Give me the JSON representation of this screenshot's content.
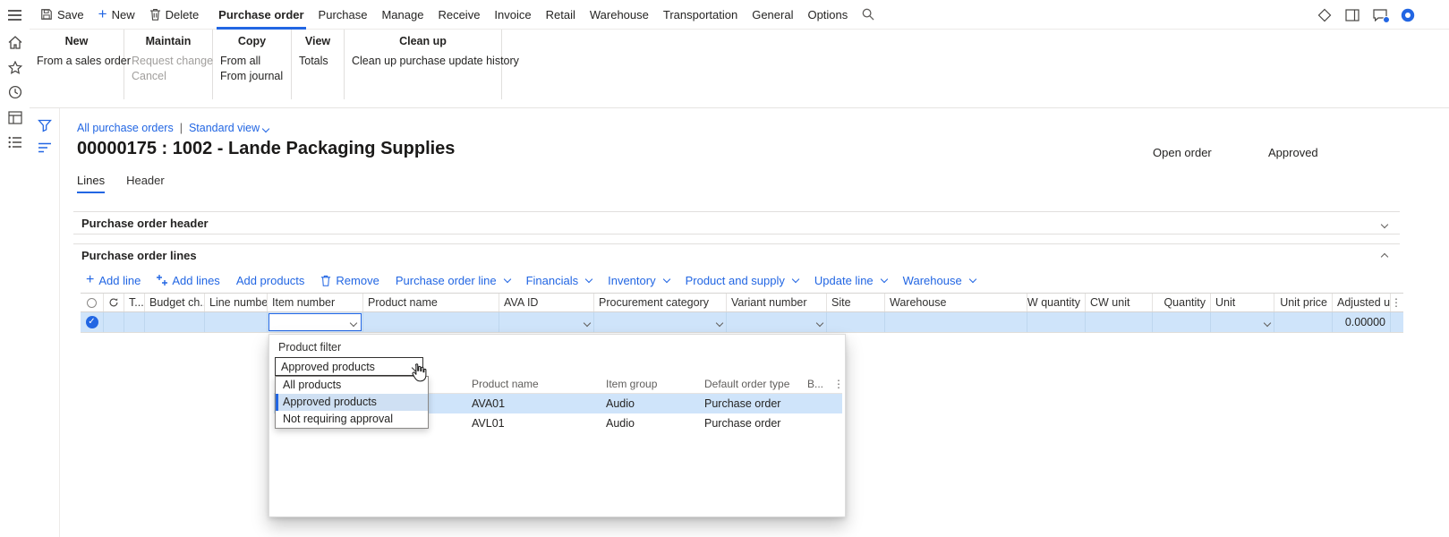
{
  "accent_color": "#2266E3",
  "row_selection_color": "#CFE4FA",
  "topbar": {
    "save": "Save",
    "new": "New",
    "delete": "Delete",
    "menus": [
      "Purchase order",
      "Purchase",
      "Manage",
      "Receive",
      "Invoice",
      "Retail",
      "Warehouse",
      "Transportation",
      "General",
      "Options"
    ]
  },
  "ribbon": {
    "groups": [
      {
        "title": "New",
        "items": [
          "From a sales order"
        ]
      },
      {
        "title": "Maintain",
        "items": [
          "Request change",
          "Cancel"
        ]
      },
      {
        "title": "Copy",
        "items": [
          "From all",
          "From journal"
        ]
      },
      {
        "title": "View",
        "items": [
          "Totals"
        ]
      },
      {
        "title": "Clean up",
        "items": [
          "Clean up purchase update history"
        ]
      }
    ]
  },
  "page": {
    "breadcrumb": "All purchase orders",
    "separator": "|",
    "view_selector": "Standard view",
    "title": "00000175 : 1002 - Lande Packaging Supplies",
    "order_status": "Open order",
    "approval_status": "Approved",
    "tabs": [
      "Lines",
      "Header"
    ]
  },
  "sections": {
    "header": "Purchase order header",
    "lines": "Purchase order lines"
  },
  "lines_toolbar": {
    "items": [
      "Add line",
      "Add lines",
      "Add products",
      "Remove",
      "Purchase order line",
      "Financials",
      "Inventory",
      "Product and supply",
      "Update line",
      "Warehouse"
    ]
  },
  "grid": {
    "columns": [
      "T...",
      "Budget ch...",
      "Line number",
      "Item number",
      "Product name",
      "AVA ID",
      "Procurement category",
      "Variant number",
      "Site",
      "Warehouse",
      "CW quantity",
      "CW unit",
      "Quantity",
      "Unit",
      "Unit price",
      "Adjusted u..."
    ],
    "selected_row": {
      "adjusted_unit_price": "0.00000"
    }
  },
  "product_flyout": {
    "filter_label": "Product filter",
    "filter_value": "Approved products",
    "options": [
      "All products",
      "Approved products",
      "Not requiring approval"
    ],
    "selected_option_index": 1,
    "grid_columns": [
      "Product name",
      "Item group",
      "Default order type",
      "B..."
    ],
    "rows": [
      {
        "product_name": "AVA01",
        "item_group": "Audio",
        "default_order_type": "Purchase order"
      },
      {
        "product_name": "AVL01",
        "item_group": "Audio",
        "default_order_type": "Purchase order"
      }
    ]
  }
}
